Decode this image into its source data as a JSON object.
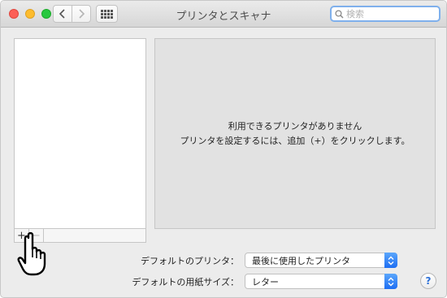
{
  "window": {
    "title": "プリンタとスキャナ"
  },
  "toolbar": {
    "back_icon": "chevron-left-icon",
    "forward_icon": "chevron-right-icon",
    "grid_icon": "grid-icon"
  },
  "search": {
    "placeholder": "検索",
    "value": ""
  },
  "printer_list": {
    "items": [],
    "add_label": "+",
    "remove_label": "−"
  },
  "detail": {
    "line1": "利用できるプリンタがありません",
    "line2": "プリンタを設定するには、追加（+）をクリックします。"
  },
  "settings": {
    "default_printer_label": "デフォルトのプリンタ：",
    "default_printer_value": "最後に使用したプリンタ",
    "paper_size_label": "デフォルトの用紙サイズ：",
    "paper_size_value": "レター"
  },
  "help": {
    "label": "?"
  },
  "colors": {
    "accent": "#1d6ef3",
    "close": "#fc5f57",
    "minimize": "#fdbc2e",
    "maximize": "#28c840"
  }
}
